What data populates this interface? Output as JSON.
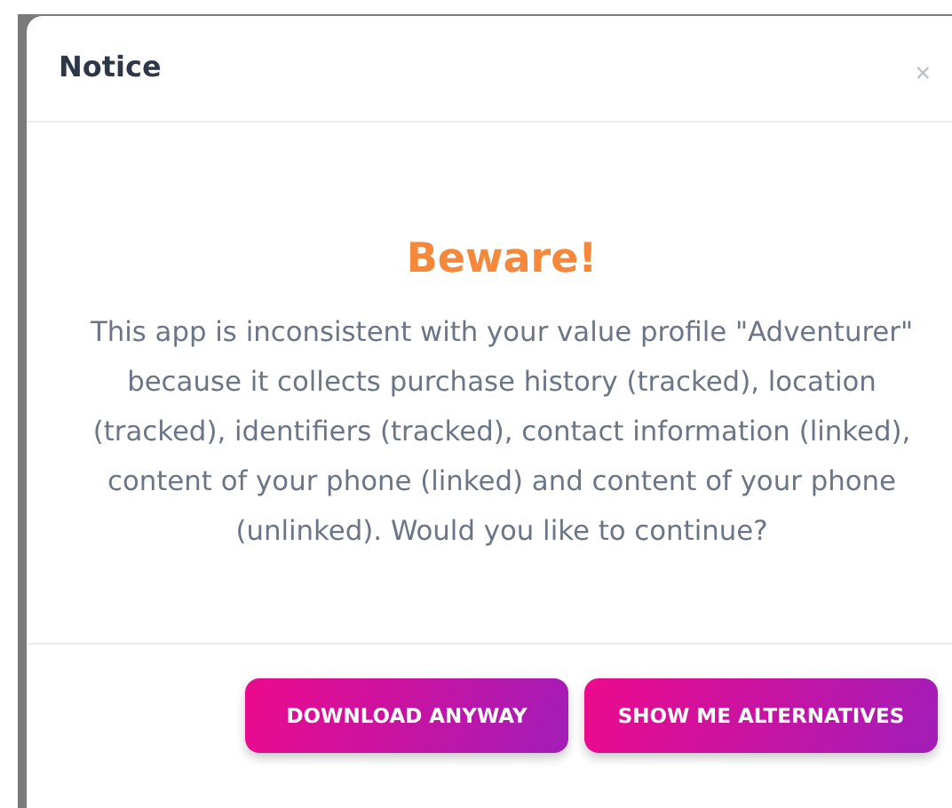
{
  "dialog": {
    "title": "Notice",
    "close": "×",
    "heading": "Beware!",
    "message": "This app is inconsistent with your value profile \"Adventurer\" because it collects purchase history (tracked), location (tracked), identifiers (tracked), contact information (linked), content of your phone (linked) and content of your phone (unlinked). Would you like to continue?",
    "buttons": [
      "DOWNLOAD ANYWAY",
      "SHOW ME ALTERNATIVES"
    ]
  }
}
